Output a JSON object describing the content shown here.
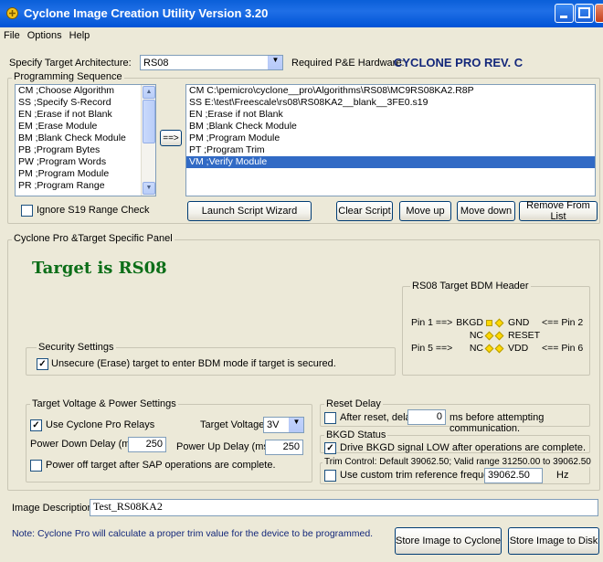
{
  "window": {
    "title": "Cyclone Image Creation Utility Version 3.20"
  },
  "menu": [
    "File",
    "Options",
    "Help"
  ],
  "target_arch": {
    "label": "Specify Target Architecture:",
    "value": "RS08"
  },
  "hardware": {
    "label": "Required P&E Hardware:",
    "value": "CYCLONE PRO REV. C"
  },
  "programming": {
    "group_label": "Programming Sequence",
    "commands": [
      "CM ;Choose Algorithm",
      "SS ;Specify S-Record",
      "EN ;Erase if not Blank",
      "EM ;Erase Module",
      "BM ;Blank Check Module",
      "PB ;Program Bytes",
      "PW ;Program Words",
      "PM ;Program Module",
      "PR ;Program Range"
    ],
    "add_button": "==>",
    "script": [
      "CM  C:\\pemicro\\cyclone__pro\\Algorithms\\RS08\\MC9RS08KA2.R8P",
      "SS  E:\\test\\Freescale\\rs08\\RS08KA2__blank__3FE0.s19",
      "EN  ;Erase if not Blank",
      "BM  ;Blank Check Module",
      "PM  ;Program Module",
      "PT  ;Program Trim",
      "VM  ;Verify Module"
    ],
    "selected_index": 6,
    "ignore_label": "Ignore S19 Range Check",
    "buttons": {
      "wizard": "Launch Script  Wizard",
      "clear": "Clear Script",
      "up": "Move up",
      "down": "Move down",
      "remove": "Remove From List"
    }
  },
  "panel": {
    "label": "Cyclone Pro &Target Specific Panel",
    "target_text": "Target is RS08",
    "security": {
      "label": "Security Settings",
      "option": "Unsecure (Erase) target to enter BDM mode if target is secured."
    },
    "bdm": {
      "label": "RS08 Target BDM Header",
      "rows": [
        {
          "left": "Pin 1 ==>",
          "a": "BKGD",
          "b": "GND",
          "right": "<== Pin 2"
        },
        {
          "left": "",
          "a": "NC",
          "b": "RESET",
          "right": ""
        },
        {
          "left": "Pin 5 ==>",
          "a": "NC",
          "b": "VDD",
          "right": "<== Pin 6"
        }
      ]
    }
  },
  "voltage": {
    "label": "Target Voltage & Power Settings",
    "relays": "Use Cyclone Pro Relays",
    "tv_label": "Target Voltage:",
    "tv_value": "3V",
    "down_label": "Power Down Delay (ms):",
    "down_value": "250",
    "up_label": "Power Up Delay (ms):",
    "up_value": "250",
    "power_off": "Power off target after SAP operations are complete."
  },
  "reset": {
    "label": "Reset Delay",
    "prefix": "After reset, delay",
    "value": "0",
    "suffix": "ms before attempting communication."
  },
  "bkgd": {
    "label": "BKGD Status",
    "option": "Drive BKGD signal LOW after operations are complete."
  },
  "trim": {
    "label": "Trim Control: Default 39062.50; Valid range 31250.00 to 39062.50",
    "option": "Use custom trim reference frequency :",
    "value": "39062.50",
    "unit": "Hz"
  },
  "image_desc": {
    "label": "Image Description:",
    "value": "Test_RS08KA2"
  },
  "note": "Note: Cyclone Pro will calculate a proper trim value for the device to be programmed.",
  "store": {
    "cyclone": "Store Image to Cyclone",
    "disk": "Store Image to Disk"
  }
}
